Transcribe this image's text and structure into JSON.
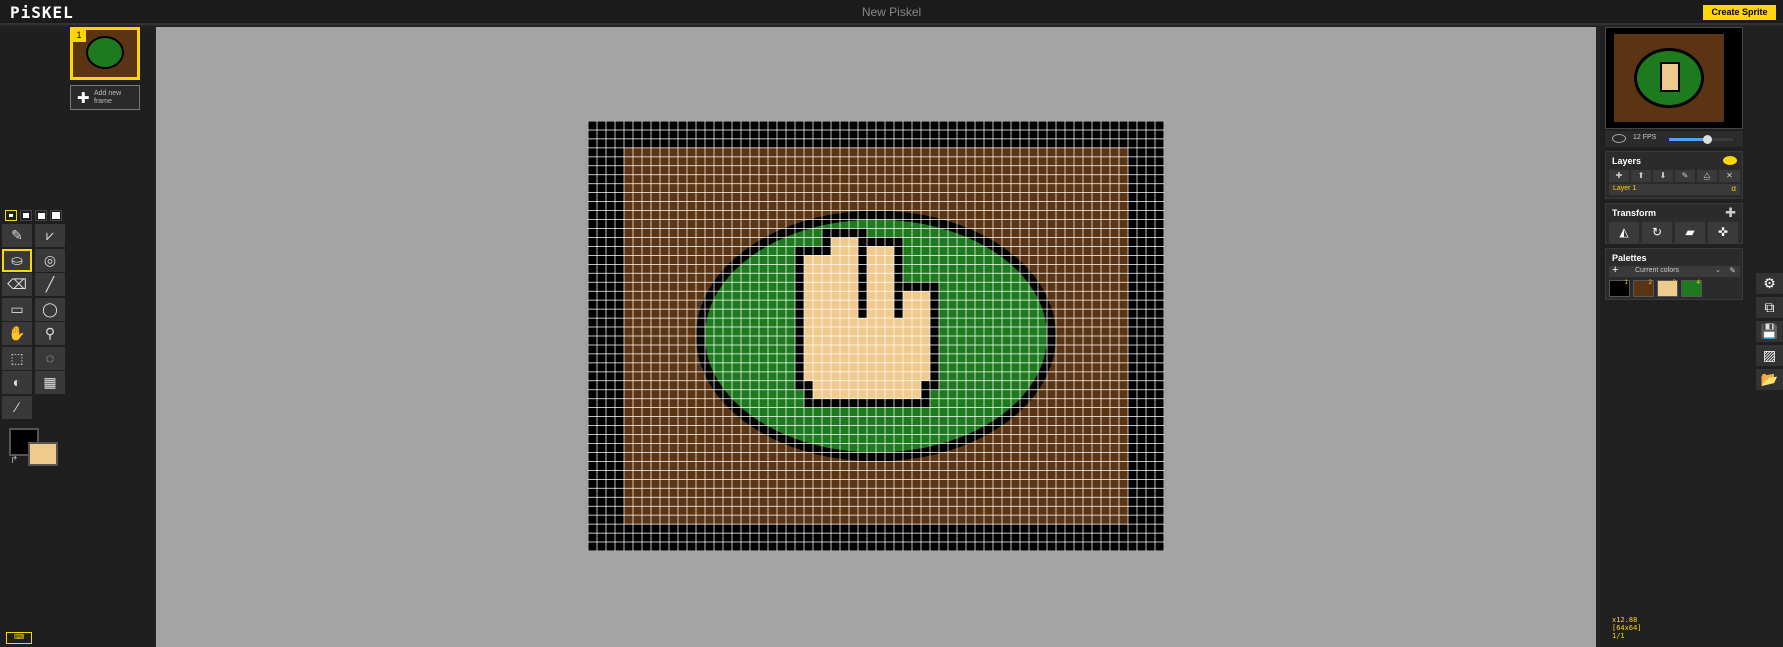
{
  "app": {
    "logo": "PiSKEL",
    "title": "New Piskel",
    "create_button": "Create Sprite"
  },
  "frames": {
    "items": [
      {
        "number": "1"
      }
    ],
    "add_label": "Add new frame"
  },
  "tools": {
    "pen_sizes": [
      "1",
      "2",
      "3",
      "4"
    ],
    "items": [
      {
        "name": "pen-tool",
        "glyph": "✎"
      },
      {
        "name": "vertical-mirror-pen-tool",
        "glyph": "⩗"
      },
      {
        "name": "paint-bucket-tool",
        "glyph": "⛀"
      },
      {
        "name": "paint-all-same-color-tool",
        "glyph": "◎"
      },
      {
        "name": "eraser-tool",
        "glyph": "⌫"
      },
      {
        "name": "stroke-tool",
        "glyph": "╱"
      },
      {
        "name": "rectangle-tool",
        "glyph": "▭"
      },
      {
        "name": "circle-tool",
        "glyph": "◯"
      },
      {
        "name": "move-tool",
        "glyph": "✋"
      },
      {
        "name": "shape-selection-tool",
        "glyph": "⚲"
      },
      {
        "name": "rectangle-selection-tool",
        "glyph": "⬚"
      },
      {
        "name": "lasso-selection-tool",
        "glyph": "◌"
      },
      {
        "name": "lighten-tool",
        "glyph": "◐"
      },
      {
        "name": "dithering-tool",
        "glyph": "▦"
      },
      {
        "name": "color-picker-tool",
        "glyph": "⁄"
      }
    ],
    "active_tool": "paint-bucket-tool",
    "primary_color": "#000000",
    "secondary_color": "#f0c98c"
  },
  "preview": {
    "fps_label": "12 FPS",
    "fps_level": 0.6
  },
  "layers": {
    "title": "Layers",
    "items": [
      {
        "name": "Layer 1",
        "alpha": "α"
      }
    ]
  },
  "transform": {
    "title": "Transform"
  },
  "palettes": {
    "title": "Palettes",
    "selected": "Current colors",
    "colors": [
      {
        "num": "1",
        "hex": "#000000"
      },
      {
        "num": "2",
        "hex": "#5a3413"
      },
      {
        "num": "3",
        "hex": "#f0c98c"
      },
      {
        "num": "4",
        "hex": "#1e7a1e"
      }
    ]
  },
  "status": {
    "zoom": "x12.88",
    "size": "[64x64]",
    "frame": "1/1"
  },
  "colors": {
    "accent": "#ffd700",
    "brown": "#5a3413",
    "green": "#1e7a1e",
    "skin": "#f0c98c",
    "black": "#000000"
  }
}
